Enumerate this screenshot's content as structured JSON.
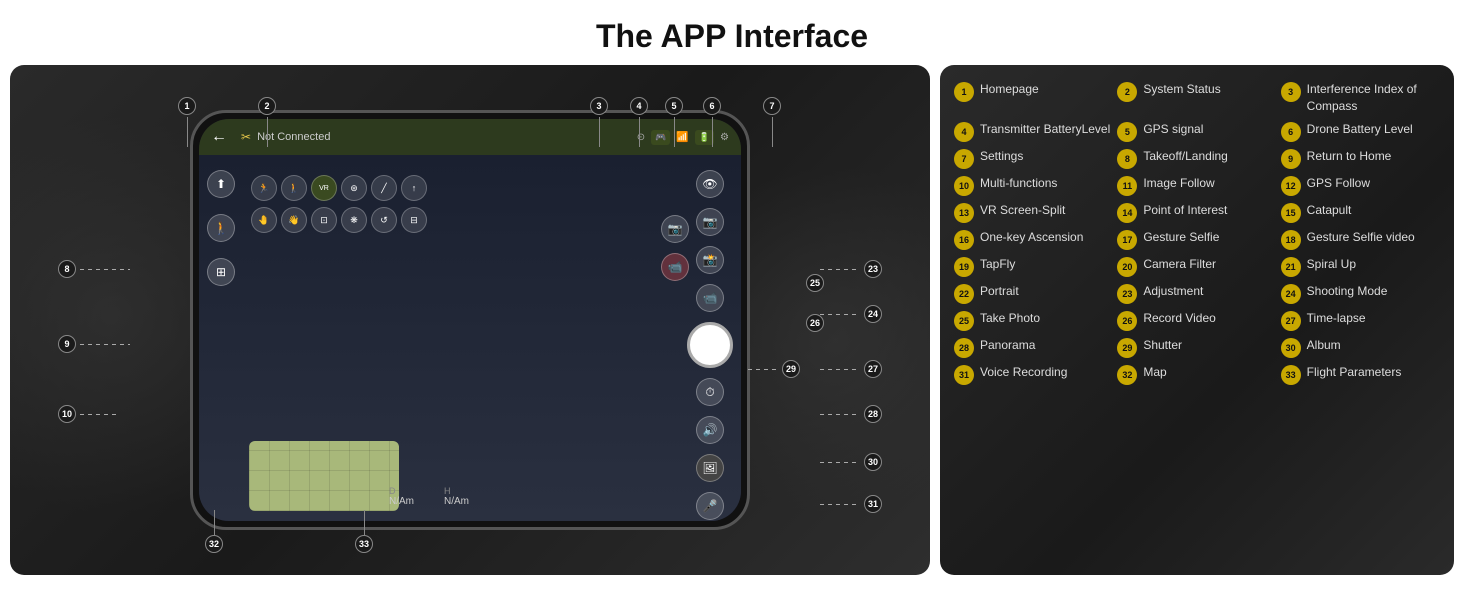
{
  "title": "The APP Interface",
  "legend": [
    {
      "num": "1",
      "text": "Homepage"
    },
    {
      "num": "2",
      "text": "System Status"
    },
    {
      "num": "3",
      "text": "Interference Index of Compass"
    },
    {
      "num": "4",
      "text": "Transmitter BatteryLevel"
    },
    {
      "num": "5",
      "text": "GPS signal"
    },
    {
      "num": "6",
      "text": "Drone Battery Level"
    },
    {
      "num": "7",
      "text": "Settings"
    },
    {
      "num": "8",
      "text": "Takeoff/Landing"
    },
    {
      "num": "9",
      "text": "Return to Home"
    },
    {
      "num": "10",
      "text": "Multi-functions"
    },
    {
      "num": "11",
      "text": "Image Follow"
    },
    {
      "num": "12",
      "text": "GPS Follow"
    },
    {
      "num": "13",
      "text": "VR Screen-Split"
    },
    {
      "num": "14",
      "text": "Point of Interest"
    },
    {
      "num": "15",
      "text": "Catapult"
    },
    {
      "num": "16",
      "text": "One-key Ascension"
    },
    {
      "num": "17",
      "text": "Gesture Selfie"
    },
    {
      "num": "18",
      "text": "Gesture Selfie video"
    },
    {
      "num": "19",
      "text": "TapFly"
    },
    {
      "num": "20",
      "text": "Camera Filter"
    },
    {
      "num": "21",
      "text": "Spiral Up"
    },
    {
      "num": "22",
      "text": "Portrait"
    },
    {
      "num": "23",
      "text": "Adjustment"
    },
    {
      "num": "24",
      "text": "Shooting Mode"
    },
    {
      "num": "25",
      "text": "Take Photo"
    },
    {
      "num": "26",
      "text": "Record Video"
    },
    {
      "num": "27",
      "text": "Time-lapse"
    },
    {
      "num": "28",
      "text": "Panorama"
    },
    {
      "num": "29",
      "text": "Shutter"
    },
    {
      "num": "30",
      "text": "Album"
    },
    {
      "num": "31",
      "text": "Voice Recording"
    },
    {
      "num": "32",
      "text": "Map"
    },
    {
      "num": "33",
      "text": "Flight Parameters"
    }
  ],
  "phone": {
    "status": "Not Connected",
    "d_label": "D",
    "h_label": "H",
    "d_value": "N/Am",
    "h_value": "N/Am"
  }
}
